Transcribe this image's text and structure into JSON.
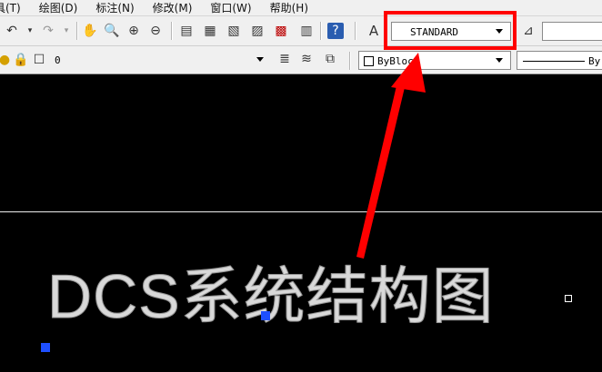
{
  "menu": [
    "具(T)",
    "绘图(D)",
    "标注(N)",
    "修改(M)",
    "窗口(W)",
    "帮助(H)"
  ],
  "text_style_combo": {
    "value": "STANDARD"
  },
  "layer_combo": {
    "value": "0"
  },
  "color_combo": {
    "value": "ByBlock"
  },
  "linetype_combo": {
    "value": "By"
  },
  "drawing": {
    "text": "DCS系统结构图"
  },
  "annotation_color": "#ff0000",
  "grip_color": "#1e4fff"
}
